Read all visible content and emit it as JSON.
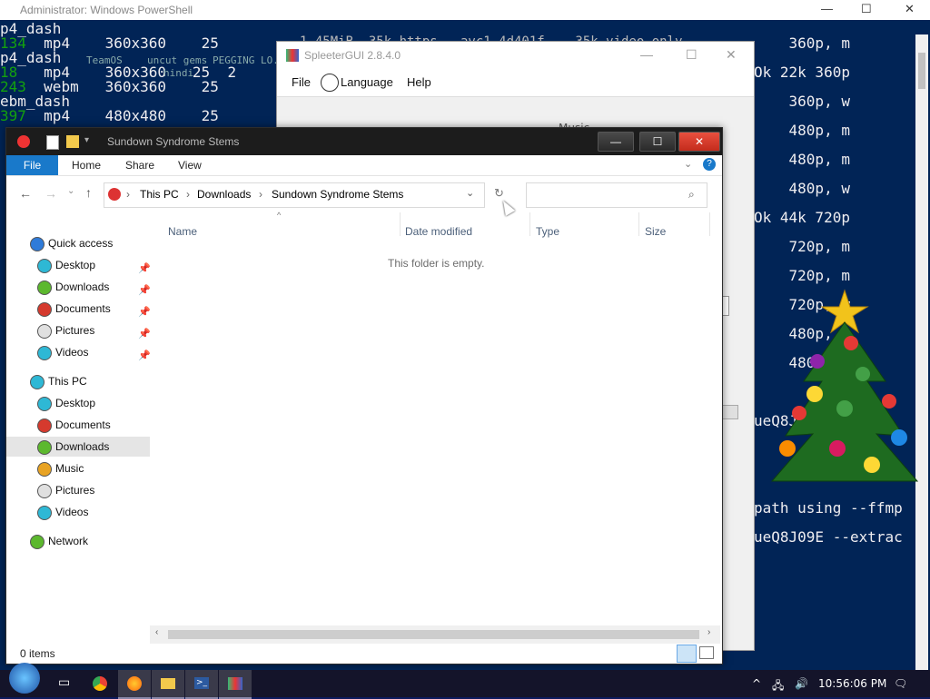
{
  "powershell": {
    "title": "Administrator: Windows PowerShell",
    "left_lines": [
      {
        "text": "p4_dash",
        "color": "white"
      },
      {
        "text": "134  mp4    360x360    25",
        "color": "mixed"
      },
      {
        "text": "p4_dash",
        "color": "white"
      },
      {
        "text": "18   mp4    360x360   25  2",
        "color": "mixed"
      },
      {
        "text": "243  webm   360x360    25",
        "color": "mixed"
      },
      {
        "text": "ebm_dash",
        "color": "white"
      },
      {
        "text": "397  mp4    480x480    25",
        "color": "mixed"
      }
    ],
    "desktop_labels": [
      "uncut gems",
      "hindi",
      "PEGGING LO...",
      "TeamOS"
    ],
    "top_fragment": "1.45MiB  35k https   avc1.4d401f    35k video only",
    "right_lines": [
      "    360p, m",
      "Ok 22k 360p",
      "    360p, w",
      "    480p, m",
      "    480p, m",
      "    480p, w",
      "Ok 44k 720p",
      "    720p, m",
      "    720p, m",
      "    720p, w",
      "    480p,",
      "    480p,",
      "",
      "ueQ8J",
      "",
      "",
      "path using --ffmp",
      "ueQ8J09E --extrac"
    ]
  },
  "spleeter": {
    "title": "SpleeterGUI 2.8.4.0",
    "menu": [
      "File",
      "Language",
      "Help"
    ],
    "body_fragment": "Music"
  },
  "explorer": {
    "title": "Sundown Syndrome Stems",
    "ribbon_tabs": [
      "File",
      "Home",
      "Share",
      "View"
    ],
    "breadcrumb": [
      "This PC",
      "Downloads",
      "Sundown Syndrome Stems"
    ],
    "search_placeholder": "",
    "columns": [
      "Name",
      "Date modified",
      "Type",
      "Size"
    ],
    "empty_message": "This folder is empty.",
    "status": "0 items",
    "sidebar": [
      {
        "label": "Quick access",
        "level": 0,
        "icon": "star-icon",
        "color": "#2f7bd9"
      },
      {
        "label": "Desktop",
        "level": 1,
        "icon": "desktop-icon",
        "color": "#2eb8d5",
        "pinned": true
      },
      {
        "label": "Downloads",
        "level": 1,
        "icon": "downloads-icon",
        "color": "#5cb82e",
        "pinned": true
      },
      {
        "label": "Documents",
        "level": 1,
        "icon": "documents-icon",
        "color": "#d53a2e",
        "pinned": true
      },
      {
        "label": "Pictures",
        "level": 1,
        "icon": "pictures-icon",
        "color": "#e0e0e0",
        "pinned": true
      },
      {
        "label": "Videos",
        "level": 1,
        "icon": "videos-icon",
        "color": "#2eb8d5",
        "pinned": true
      },
      {
        "label": "This PC",
        "level": 0,
        "icon": "this-pc-icon",
        "color": "#2eb8d5"
      },
      {
        "label": "Desktop",
        "level": 1,
        "icon": "desktop-icon",
        "color": "#2eb8d5"
      },
      {
        "label": "Documents",
        "level": 1,
        "icon": "documents-icon",
        "color": "#d53a2e"
      },
      {
        "label": "Downloads",
        "level": 1,
        "icon": "downloads-icon",
        "color": "#5cb82e",
        "selected": true
      },
      {
        "label": "Music",
        "level": 1,
        "icon": "music-icon",
        "color": "#e8a323"
      },
      {
        "label": "Pictures",
        "level": 1,
        "icon": "pictures-icon",
        "color": "#e0e0e0"
      },
      {
        "label": "Videos",
        "level": 1,
        "icon": "videos-icon",
        "color": "#2eb8d5"
      },
      {
        "label": "Network",
        "level": 0,
        "icon": "network-icon",
        "color": "#5cb82e"
      }
    ]
  },
  "taskbar": {
    "clock": "10:56:06 PM",
    "apps": [
      "start",
      "task-view",
      "chrome",
      "firefox",
      "file-explorer",
      "powershell",
      "spleeter"
    ]
  }
}
